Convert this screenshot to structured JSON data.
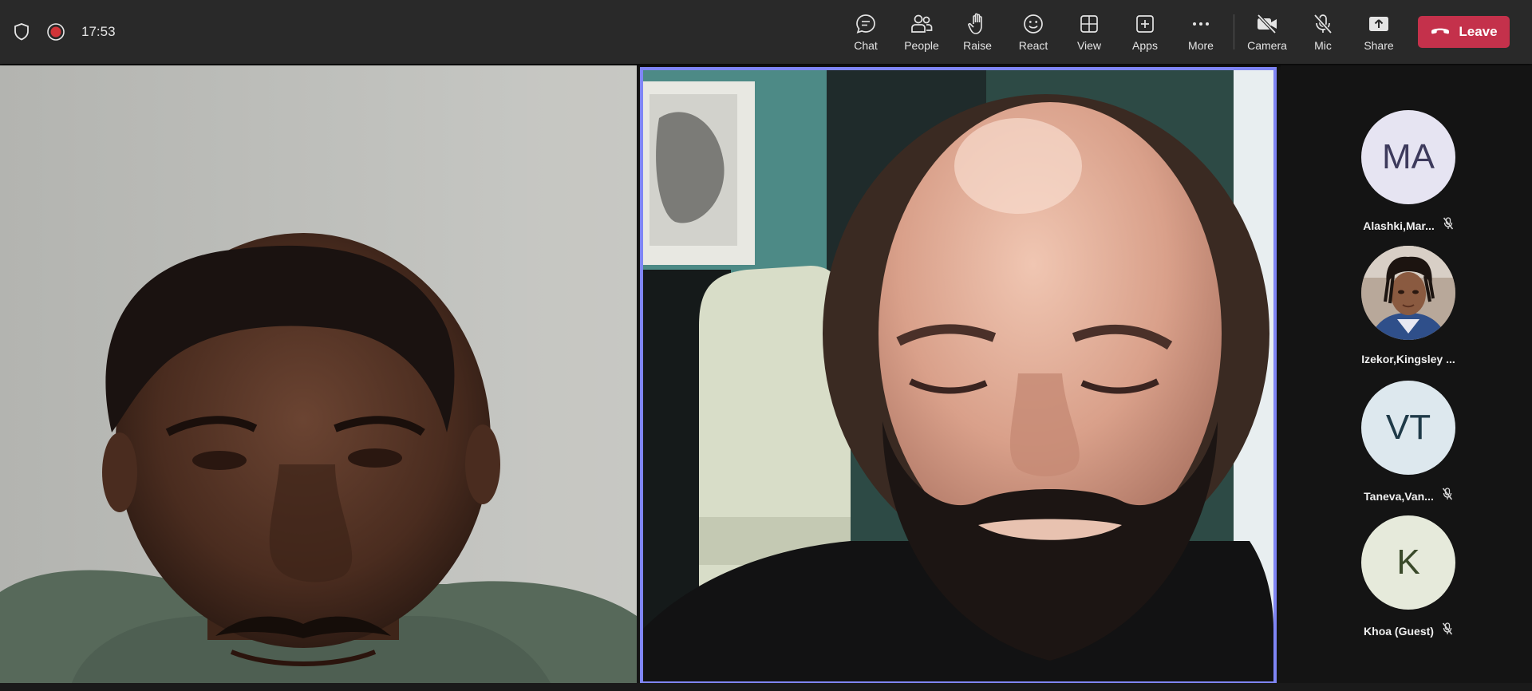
{
  "meeting": {
    "timer": "17:53"
  },
  "toolbar": {
    "chat": "Chat",
    "people": "People",
    "raise": "Raise",
    "react": "React",
    "view": "View",
    "apps": "Apps",
    "more": "More",
    "camera": "Camera",
    "mic": "Mic",
    "share": "Share",
    "leave": "Leave"
  },
  "colors": {
    "accent": "#7f85f5",
    "leave": "#c4314b",
    "record": "#d13438"
  },
  "participants": [
    {
      "initials": "MA",
      "name": "Alashki,Mar...",
      "muted": true,
      "avatar_bg": "#e6e4f2"
    },
    {
      "initials": "",
      "name": "Izekor,Kingsley ...",
      "muted": false,
      "avatar_type": "photo"
    },
    {
      "initials": "VT",
      "name": "Taneva,Van...",
      "muted": true,
      "avatar_bg": "#dde8ee"
    },
    {
      "initials": "K",
      "name": "Khoa (Guest)",
      "muted": true,
      "avatar_bg": "#e6eadb"
    }
  ]
}
